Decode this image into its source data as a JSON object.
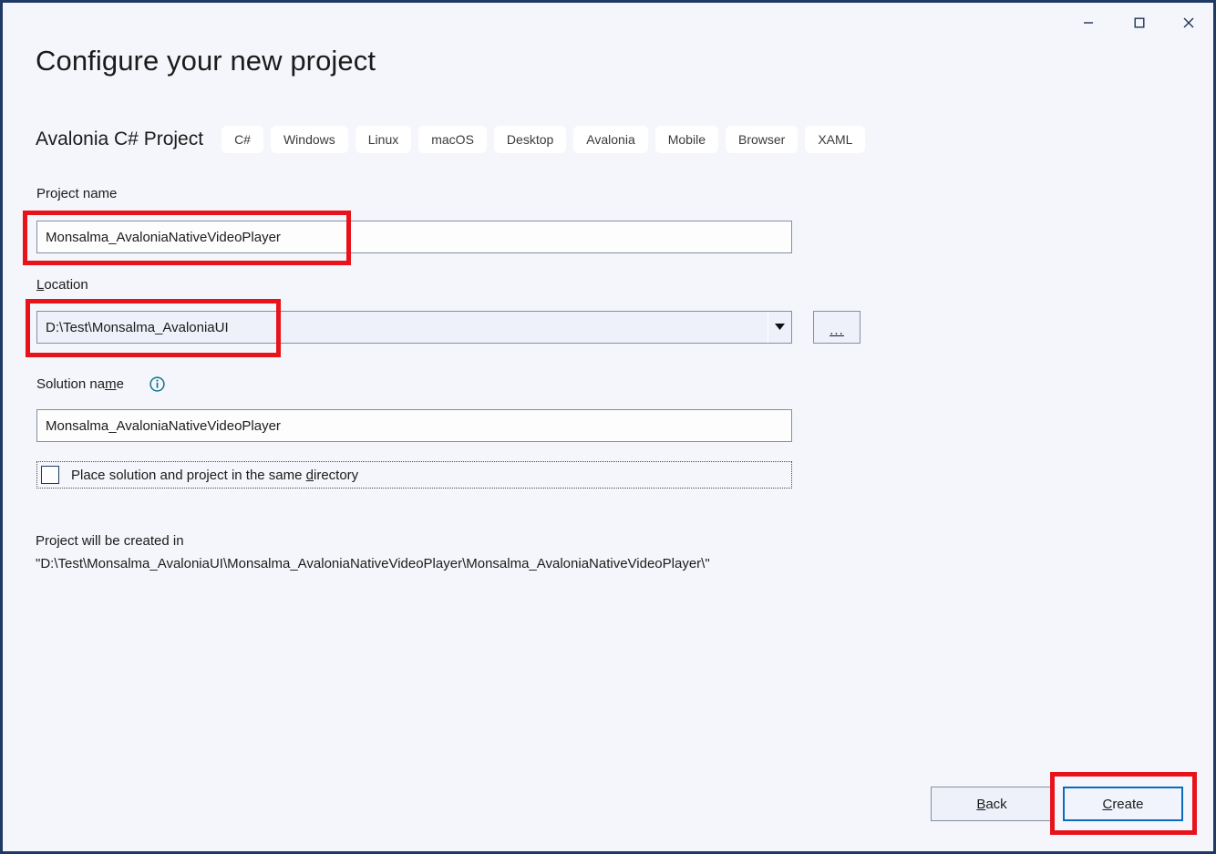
{
  "window": {
    "controls": [
      {
        "name": "minimize",
        "label": "—"
      },
      {
        "name": "maximize",
        "label": "□"
      },
      {
        "name": "close",
        "label": "✕"
      }
    ]
  },
  "header": {
    "title": "Configure your new project",
    "template_name": "Avalonia C# Project",
    "tags": [
      "C#",
      "Windows",
      "Linux",
      "macOS",
      "Desktop",
      "Avalonia",
      "Mobile",
      "Browser",
      "XAML"
    ]
  },
  "fields": {
    "project_name": {
      "label": "Project name",
      "value": "Monsalma_AvaloniaNativeVideoPlayer",
      "placeholder": ""
    },
    "location": {
      "label_prefix": "",
      "label_accel": "L",
      "label_suffix": "ocation",
      "value": "D:\\Test\\Monsalma_AvaloniaUI",
      "placeholder": "",
      "dropdown_icon": "chevron-down-icon",
      "browse_label": "..."
    },
    "solution_name": {
      "label_prefix": "Solution na",
      "label_accel": "m",
      "label_suffix": "e",
      "value": "Monsalma_AvaloniaNativeVideoPlayer",
      "placeholder": "",
      "info_icon": "info-icon"
    },
    "same_directory": {
      "label_prefix": "Place solution and project in the same ",
      "label_accel": "d",
      "label_suffix": "irectory",
      "checked": false
    }
  },
  "path_note": "Project will be created in \"D:\\Test\\Monsalma_AvaloniaUI\\Monsalma_AvaloniaNativeVideoPlayer\\Monsalma_AvaloniaNativeVideoPlayer\\\"",
  "footer": {
    "back": {
      "prefix": "",
      "accel": "B",
      "suffix": "ack"
    },
    "create": {
      "prefix": "",
      "accel": "C",
      "suffix": "reate"
    }
  },
  "annotations": {
    "highlight_color": "#e8121b",
    "boxes": [
      "project-name-field",
      "location-field",
      "create-button"
    ]
  },
  "colors": {
    "window_border": "#1f3864",
    "background": "#f5f6fb",
    "default_button_border": "#0a6cbf",
    "info_icon": "#12718b"
  }
}
